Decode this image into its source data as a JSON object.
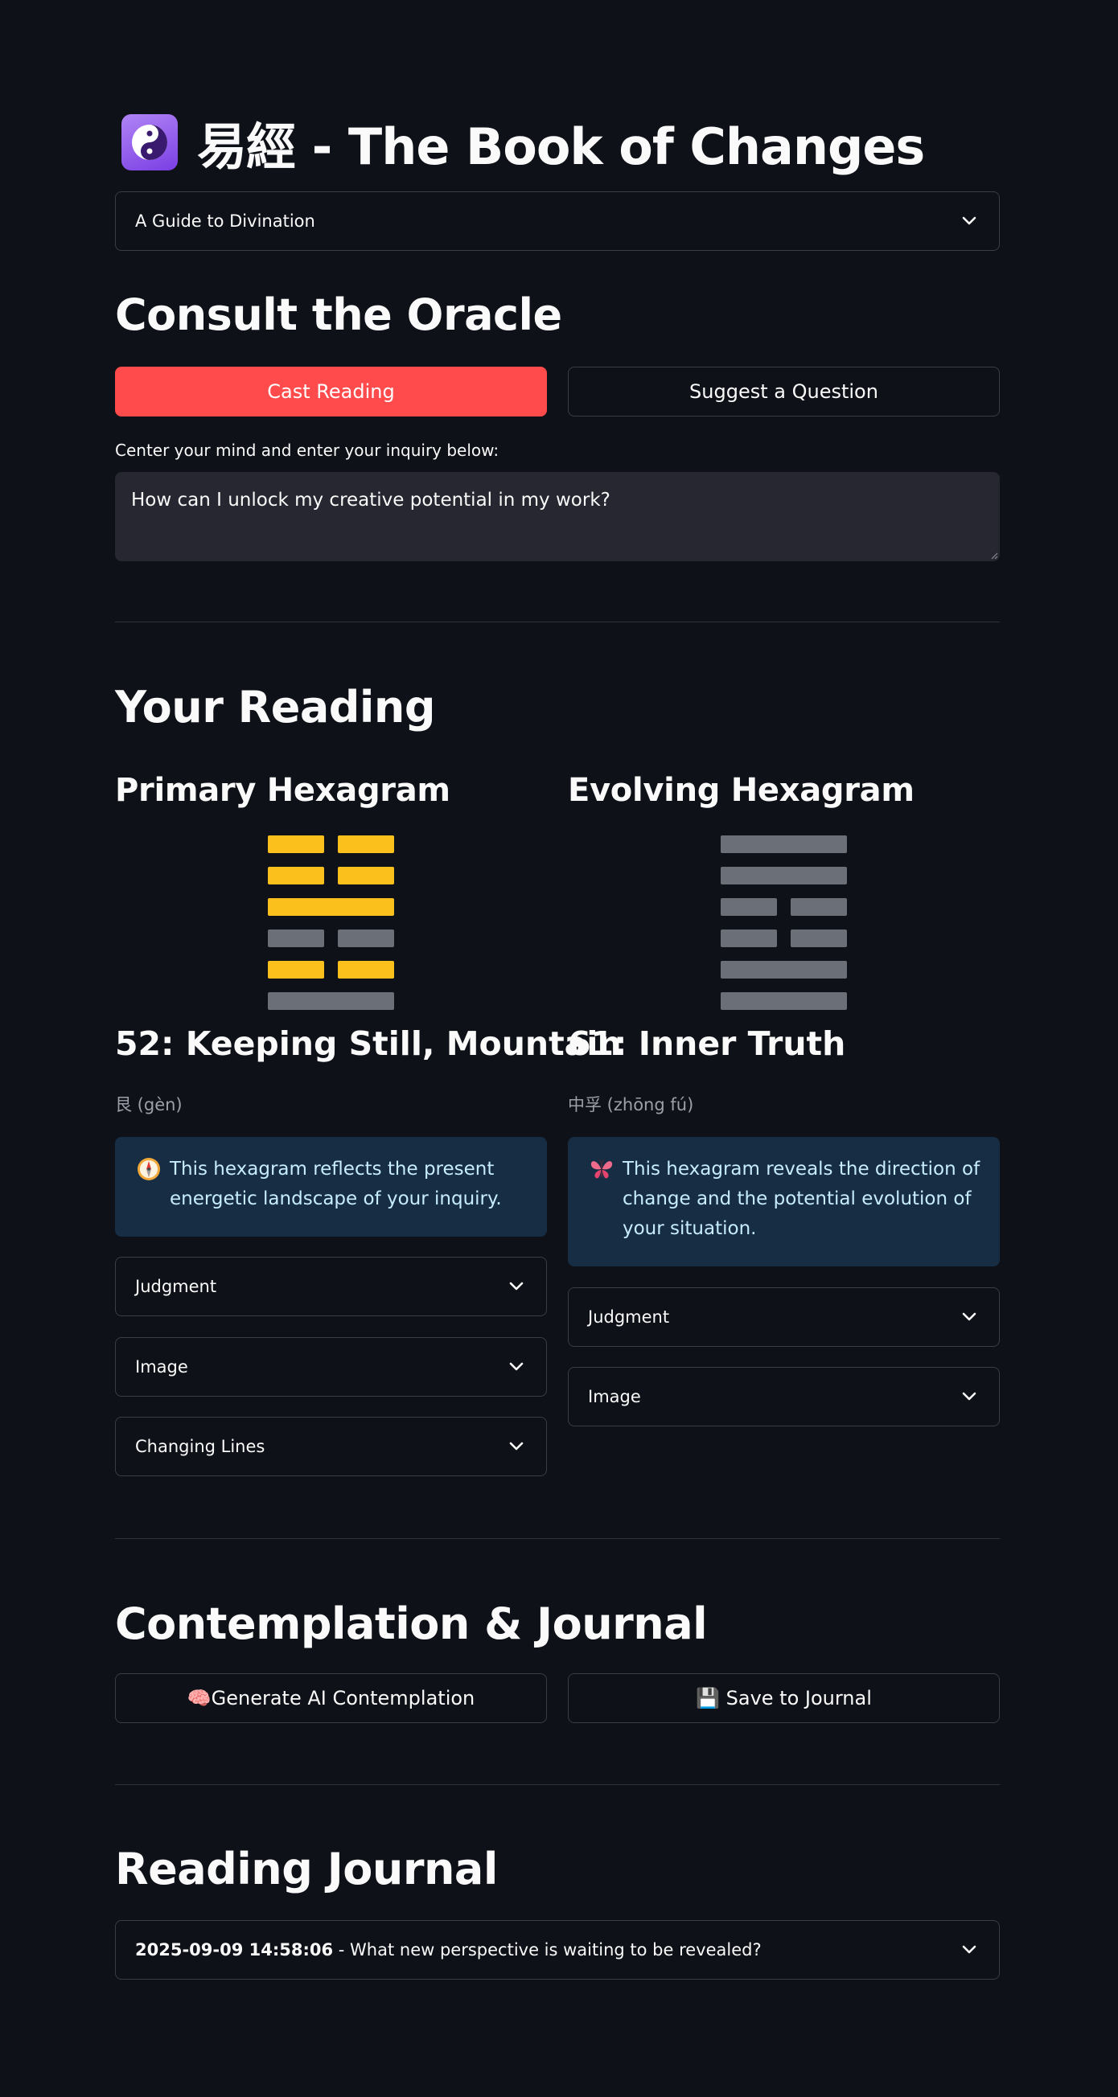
{
  "header": {
    "title": "易經 - The Book of Changes",
    "icon": "yin-yang-icon"
  },
  "guide": {
    "label": "A Guide to Divination"
  },
  "oracle": {
    "heading": "Consult the Oracle",
    "cast_label": "Cast Reading",
    "suggest_label": "Suggest a Question",
    "inquiry_label": "Center your mind and enter your inquiry below:",
    "inquiry_value": "How can I unlock my creative potential in my work?"
  },
  "reading": {
    "heading": "Your Reading",
    "primary": {
      "heading": "Primary Hexagram",
      "title": "52: Keeping Still, Mountain",
      "chinese": "艮 (gèn)",
      "info": "This hexagram reflects the present energetic landscape of your inquiry.",
      "info_icon": "compass-icon",
      "lines": [
        {
          "type": "broken",
          "changing": true
        },
        {
          "type": "broken",
          "changing": true
        },
        {
          "type": "solid",
          "changing": true
        },
        {
          "type": "broken",
          "changing": false
        },
        {
          "type": "broken",
          "changing": true
        },
        {
          "type": "solid",
          "changing": false
        }
      ],
      "expanders": [
        "Judgment",
        "Image",
        "Changing Lines"
      ]
    },
    "evolving": {
      "heading": "Evolving Hexagram",
      "title": "61: Inner Truth",
      "chinese": "中孚 (zhōng fú)",
      "info": "This hexagram reveals the direction of change and the potential evolution of your situation.",
      "info_icon": "butterfly-icon",
      "lines": [
        {
          "type": "solid",
          "changing": false
        },
        {
          "type": "solid",
          "changing": false
        },
        {
          "type": "broken",
          "changing": false
        },
        {
          "type": "broken",
          "changing": false
        },
        {
          "type": "solid",
          "changing": false
        },
        {
          "type": "solid",
          "changing": false
        }
      ],
      "expanders": [
        "Judgment",
        "Image"
      ]
    }
  },
  "contemplation": {
    "heading": "Contemplation & Journal",
    "generate_label": "🧠Generate AI Contemplation",
    "save_label": "💾 Save to Journal"
  },
  "journal": {
    "heading": "Reading Journal",
    "entries": [
      {
        "timestamp": "2025-09-09 14:58:06",
        "question": " - What new perspective is waiting to be revealed?"
      }
    ]
  },
  "colors": {
    "background": "#0e1117",
    "primary_button": "#ff4b4b",
    "changing_line": "#fcc01c",
    "static_line": "#6b7078",
    "info_bg": "#172d43",
    "info_text": "#c7ebff"
  }
}
